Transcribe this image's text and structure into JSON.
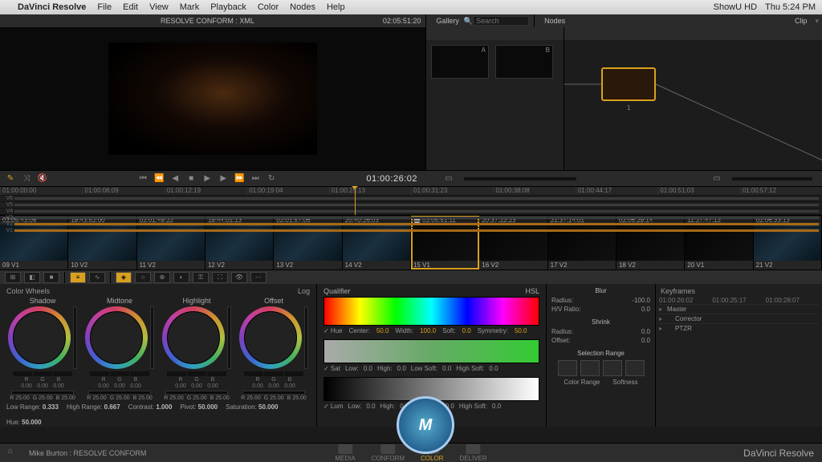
{
  "menubar": {
    "apple": "",
    "app": "DaVinci Resolve",
    "items": [
      "File",
      "Edit",
      "View",
      "Mark",
      "Playback",
      "Color",
      "Nodes",
      "Help"
    ],
    "right": {
      "showu": "ShowU HD",
      "clock": "Thu 5:24 PM"
    }
  },
  "topbar": {
    "title": "RESOLVE CONFORM : XML",
    "tc": "02:05:51:20",
    "gallery": "Gallery",
    "search_ph": "Search",
    "nodes": "Nodes",
    "clip": "Clip"
  },
  "gallery": {
    "labels": [
      "A",
      "B"
    ]
  },
  "nodes": {
    "node_label": "1"
  },
  "transport": {
    "tc": "01:00:26:02"
  },
  "timeline": {
    "marks": [
      "01:00:00:00",
      "01:00:06:09",
      "01:00:12:19",
      "01:00:19:04",
      "01:00:25:13",
      "01:00:31:23",
      "01:00:38:08",
      "01:00:44:17",
      "01:00:51:03",
      "01:00:57:12"
    ],
    "tracks": [
      "V6",
      "V5",
      "V4",
      "V3",
      "V2",
      "V1"
    ]
  },
  "clips": [
    {
      "tc": "02:05:43:08",
      "name": "09 V1",
      "dark": false
    },
    {
      "tc": "19:43:52:00",
      "name": "10 V2",
      "dark": false
    },
    {
      "tc": "02:01:49:22",
      "name": "11 V2",
      "dark": false
    },
    {
      "tc": "19:44:01:13",
      "name": "12 V2",
      "dark": false
    },
    {
      "tc": "02:01:57:06",
      "name": "13 V2",
      "dark": false
    },
    {
      "tc": "20:40:26:03",
      "name": "14 V2",
      "dark": false
    },
    {
      "tc": "02:05:51:11",
      "name": "15 V1",
      "dark": true,
      "sel": true
    },
    {
      "tc": "20:37:22:23",
      "name": "16 V2",
      "dark": true
    },
    {
      "tc": "21:37:14:01",
      "name": "17 V2",
      "dark": true
    },
    {
      "tc": "02:06:29:14",
      "name": "18 V2",
      "dark": true
    },
    {
      "tc": "11:27:47:12",
      "name": "20 V1",
      "dark": true
    },
    {
      "tc": "02:06:33:13",
      "name": "21 V2",
      "dark": false
    }
  ],
  "wheels": {
    "title": "Color Wheels",
    "mode": "Log",
    "names": [
      "Shadow",
      "Midtone",
      "Highlight",
      "Offset"
    ],
    "rgb_header": [
      "R",
      "G",
      "B"
    ],
    "zero": "0.00",
    "master": [
      {
        "l": "R",
        "v": "25.00"
      },
      {
        "l": "G",
        "v": "25.00"
      },
      {
        "l": "B",
        "v": "25.00"
      }
    ],
    "foot": [
      {
        "l": "Low Range:",
        "v": "0.333"
      },
      {
        "l": "High Range:",
        "v": "0.667"
      },
      {
        "l": "Contrast:",
        "v": "1.000"
      },
      {
        "l": "Pivot:",
        "v": "50.000"
      },
      {
        "l": "Saturation:",
        "v": "50.000"
      },
      {
        "l": "Hue:",
        "v": "50.000"
      }
    ]
  },
  "qualifier": {
    "title": "Qualifier",
    "mode": "HSL",
    "hue_row": {
      "chk": "✓ Hue",
      "center_l": "Center:",
      "center_v": "50.0",
      "width_l": "Width:",
      "width_v": "100.0",
      "soft_l": "Soft:",
      "soft_v": "0.0",
      "sym_l": "Symmetry:",
      "sym_v": "50.0"
    },
    "sat_row": {
      "chk": "✓ Sat",
      "low_l": "Low:",
      "low_v": "0.0",
      "high_l": "High:",
      "high_v": "0.0",
      "ls_l": "Low Soft:",
      "ls_v": "0.0",
      "hs_l": "High Soft:",
      "hs_v": "0.0"
    },
    "lum_row": {
      "chk": "✓ Lum",
      "low_l": "Low:",
      "low_v": "0.0",
      "high_l": "High:",
      "high_v": "0.0",
      "ls_l": "Low Soft:",
      "ls_v": "0.0",
      "hs_l": "High Soft:",
      "hs_v": "0.0"
    }
  },
  "side": {
    "blur": {
      "t": "Blur",
      "radius_l": "Radius:",
      "radius_v": "-100.0",
      "hv_l": "H/V Ratio:",
      "hv_v": "0.0"
    },
    "shrink": {
      "t": "Shrink",
      "radius_l": "Radius:",
      "radius_v": "0.0",
      "offset_l": "Offset:",
      "offset_v": "0.0"
    },
    "selrange": {
      "t": "Selection Range",
      "cr": "Color Range",
      "sf": "Softness"
    }
  },
  "keyframes": {
    "title": "Keyframes",
    "marks": [
      "01:00:26:02",
      "01:00:25:17",
      "01:00:28:07"
    ],
    "rows": [
      "Master",
      "Corrector",
      "PTZR"
    ]
  },
  "bottom": {
    "user": "Mike Burton : RESOLVE CONFORM",
    "pages": [
      "MEDIA",
      "CONFORM",
      "COLOR",
      "DELIVER"
    ],
    "brand": "DaVinci Resolve"
  },
  "logo": "M"
}
